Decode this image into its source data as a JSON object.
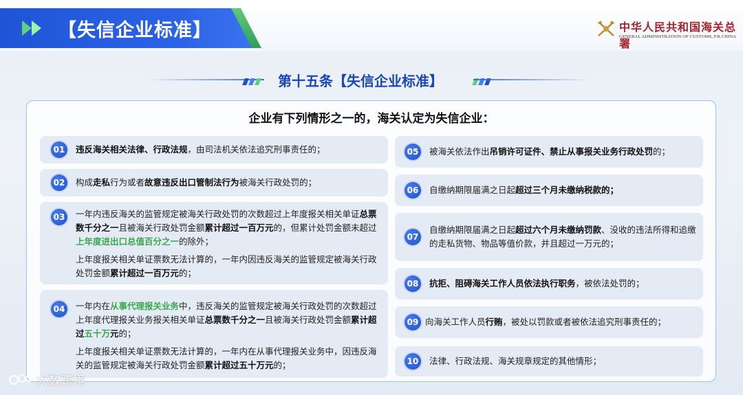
{
  "header": {
    "title": "【失信企业标准】",
    "org_name": "中华人民共和国海关总署",
    "org_name_en": "GENERAL ADMINISTRATION OF CUSTOMS, P.R.CHINA"
  },
  "article": {
    "title": "第十五条【失信企业标准】"
  },
  "intro": "企业有下列情形之一的，海关认定为失信企业：",
  "items": [
    {
      "num": "01",
      "parts": [
        [
          [
            "b",
            "违反海关相关法律、行政法规"
          ],
          [
            "t",
            "，由司法机关依法追究刑事责任的；"
          ]
        ]
      ]
    },
    {
      "num": "02",
      "parts": [
        [
          [
            "t",
            "构成"
          ],
          [
            "b",
            "走私"
          ],
          [
            "t",
            "行为或者"
          ],
          [
            "b",
            "故意违反出口管制法行为"
          ],
          [
            "t",
            "被海关行政处罚的；"
          ]
        ]
      ]
    },
    {
      "num": "03",
      "parts": [
        [
          [
            "t",
            "一年内违反海关的监管规定被海关行政处罚的次数超过上年度报关相关单证"
          ],
          [
            "b",
            "总票数千分之一"
          ],
          [
            "t",
            "且被海关行政处罚金额"
          ],
          [
            "b",
            "累计超过一百万元"
          ],
          [
            "t",
            "的，但累计处罚金额未超过"
          ],
          [
            "g",
            "上年度进出口总值百分之一"
          ],
          [
            "t",
            "的除外；"
          ]
        ],
        [
          [
            "t",
            "上年度报关相关单证票数无法计算的，一年内因违反海关的监管规定被海关行政处罚金额"
          ],
          [
            "b",
            "累计超过一百万元"
          ],
          [
            "t",
            "的；"
          ]
        ]
      ]
    },
    {
      "num": "04",
      "parts": [
        [
          [
            "t",
            "一年内在"
          ],
          [
            "g",
            "从事代理报关业务"
          ],
          [
            "t",
            "中，违反海关的监管规定被海关行政处罚的次数超过上年度代理报关业务报关相关单证"
          ],
          [
            "b",
            "总票数千分之一"
          ],
          [
            "t",
            "且被海关行政处罚金额"
          ],
          [
            "b",
            "累计超过"
          ],
          [
            "g",
            "五十万"
          ],
          [
            "b",
            "元"
          ],
          [
            "t",
            "的；"
          ]
        ],
        [
          [
            "t",
            "上年度报关相关单证票数无法计算的，一年内在从事代理报关业务中，因违反海关的监管规定被海关行政处罚金额"
          ],
          [
            "b",
            "累计超过五十万元"
          ],
          [
            "t",
            "的；"
          ]
        ]
      ]
    },
    {
      "num": "05",
      "parts": [
        [
          [
            "t",
            "被海关依法作出"
          ],
          [
            "b",
            "吊销许可证件、禁止从事报关业务行政处罚"
          ],
          [
            "t",
            "的；"
          ]
        ]
      ]
    },
    {
      "num": "06",
      "parts": [
        [
          [
            "t",
            "自缴纳期限届满之日起"
          ],
          [
            "b",
            "超过三个月未缴纳税款的；"
          ]
        ]
      ]
    },
    {
      "num": "07",
      "parts": [
        [
          [
            "t",
            "自缴纳期限届满之日起"
          ],
          [
            "b",
            "超过六个月未缴纳罚款"
          ],
          [
            "t",
            "、没收的违法所得和追缴的走私货物、物品等值价款，并且超过一万元的；"
          ]
        ]
      ]
    },
    {
      "num": "08",
      "parts": [
        [
          [
            "b",
            "抗拒、阻碍海关工作人员依法执行职务"
          ],
          [
            "t",
            "，被依法处罚的；"
          ]
        ]
      ]
    },
    {
      "num": "09",
      "parts": [
        [
          [
            "t",
            "向海关工作人员"
          ],
          [
            "b",
            "行贿"
          ],
          [
            "t",
            "，被处以罚款或者被依法追究刑事责任的；"
          ]
        ]
      ]
    },
    {
      "num": "10",
      "parts": [
        [
          [
            "t",
            "法律、行政法规、海关规章规定的其他情形；"
          ]
        ]
      ]
    }
  ],
  "watermark": "大数跨境",
  "colors": {
    "brand_blue": "#2c63e6",
    "title_blue": "#1c46b8",
    "highlight_green": "#3aa84f",
    "org_red": "#a4242c"
  }
}
